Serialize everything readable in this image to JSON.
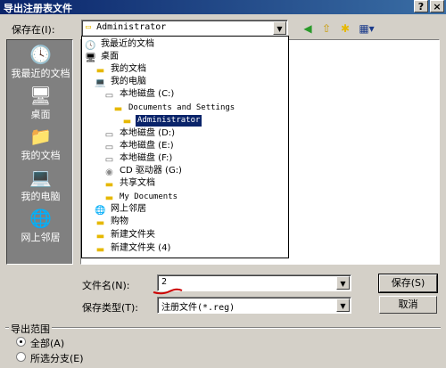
{
  "window": {
    "title": "导出注册表文件",
    "help_button": "?",
    "close_button": "×"
  },
  "location": {
    "label": "保存在(I):",
    "value": "Administrator"
  },
  "toolbar": {
    "back_icon": "back-arrow-icon",
    "up_icon": "up-folder-icon",
    "new_folder_icon": "new-folder-icon",
    "view_icon": "view-menu-icon"
  },
  "places": [
    {
      "label": "我最近的文档",
      "icon": "recent-docs-icon"
    },
    {
      "label": "桌面",
      "icon": "desktop-icon"
    },
    {
      "label": "我的文档",
      "icon": "my-documents-icon"
    },
    {
      "label": "我的电脑",
      "icon": "my-computer-icon"
    },
    {
      "label": "网上邻居",
      "icon": "network-places-icon"
    }
  ],
  "location_dropdown": [
    {
      "label": "我最近的文档",
      "icon": "recent-docs-icon"
    },
    {
      "label": "桌面",
      "icon": "desktop-icon"
    },
    {
      "label": "我的文档",
      "icon": "folder-icon"
    },
    {
      "label": "我的电脑",
      "icon": "computer-icon"
    },
    {
      "label": "本地磁盘 (C:)",
      "icon": "drive-icon"
    },
    {
      "label": "Documents and Settings",
      "icon": "folder-icon"
    },
    {
      "label": "Administrator",
      "icon": "open-folder-icon",
      "selected": true
    },
    {
      "label": "本地磁盘 (D:)",
      "icon": "drive-icon"
    },
    {
      "label": "本地磁盘 (E:)",
      "icon": "drive-icon"
    },
    {
      "label": "本地磁盘 (F:)",
      "icon": "drive-icon"
    },
    {
      "label": "CD 驱动器 (G:)",
      "icon": "cd-drive-icon"
    },
    {
      "label": "共享文档",
      "icon": "folder-icon"
    },
    {
      "label": "My Documents",
      "icon": "folder-icon"
    },
    {
      "label": "网上邻居",
      "icon": "network-places-icon"
    },
    {
      "label": "购物",
      "icon": "folder-icon"
    },
    {
      "label": "新建文件夹",
      "icon": "folder-icon"
    },
    {
      "label": "新建文件夹 (4)",
      "icon": "folder-icon"
    }
  ],
  "filename": {
    "label": "文件名(N):",
    "value": "2"
  },
  "filetype": {
    "label": "保存类型(T):",
    "value": "注册文件(*.reg)"
  },
  "buttons": {
    "save": "保存(S)",
    "cancel": "取消"
  },
  "export_range": {
    "title": "导出范围",
    "options": [
      {
        "label": "全部(A)",
        "checked": true
      },
      {
        "label": "所选分支(E)",
        "checked": false
      }
    ]
  },
  "colors": {
    "title_bar": "#0a246a",
    "highlight": "#0a246a",
    "face": "#d4d0c8",
    "annotation_red": "#cc0000"
  }
}
